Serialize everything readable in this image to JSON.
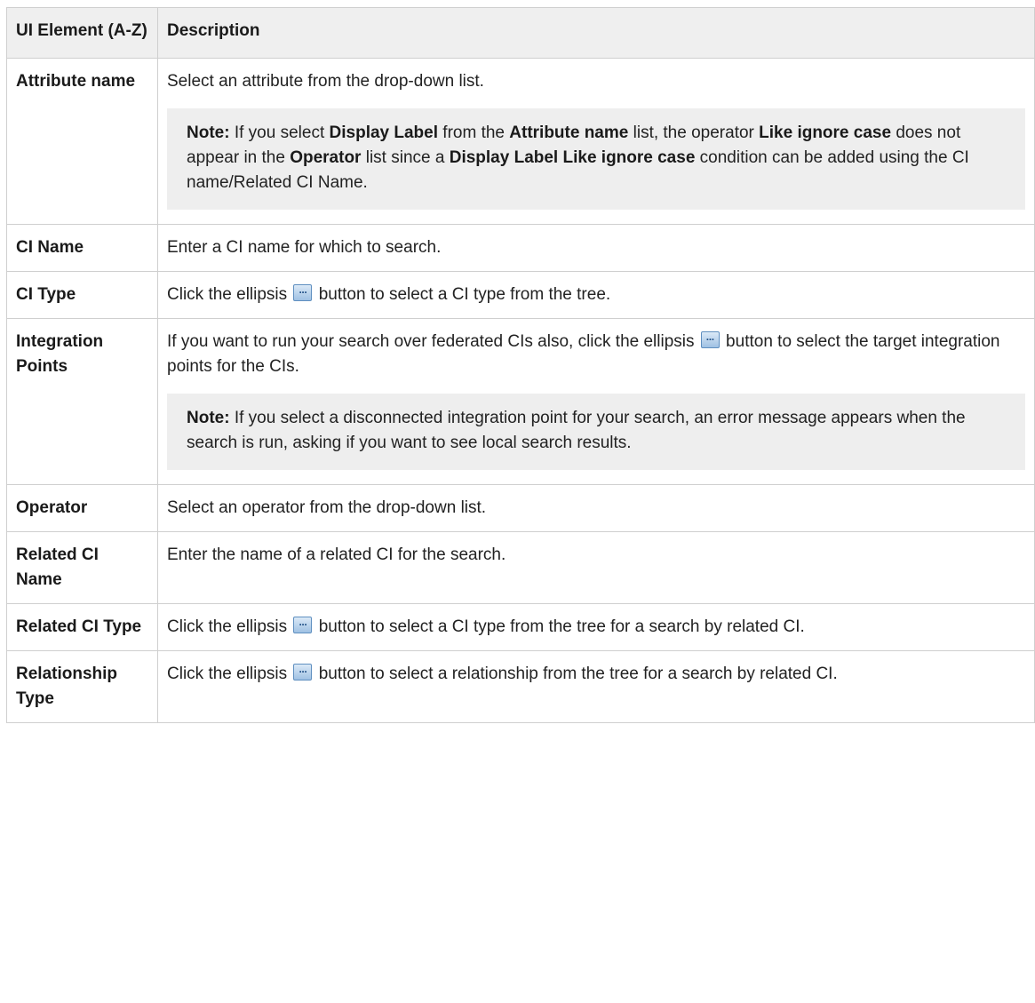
{
  "header": {
    "col1": "UI Element (A-Z)",
    "col2": "Description"
  },
  "icons": {
    "ellipsis_button": "ellipsis-button-icon",
    "ellipsis_glyph": "···"
  },
  "rows": {
    "attribute_name": {
      "element": "Attribute name",
      "desc": "Select an attribute from the drop-down list.",
      "note": {
        "label": "Note:",
        "t1": " If you select ",
        "b1": "Display Label",
        "t2": " from the ",
        "b2": "Attribute name",
        "t3": " list, the operator ",
        "b3": "Like ignore case",
        "t4": " does not appear in the ",
        "b4": "Operator",
        "t5": " list since a ",
        "b5": "Display Label Like ignore case",
        "t6": " condition can be added using the CI name/Related CI Name."
      }
    },
    "ci_name": {
      "element": "CI Name",
      "desc": "Enter a CI name for which to search."
    },
    "ci_type": {
      "element": "CI Type",
      "desc_before": "Click the ellipsis ",
      "desc_after": " button to select a CI type from the tree."
    },
    "integration_points": {
      "element": "Integration Points",
      "desc_before": "If you want to run your search over federated CIs also, click the ellipsis ",
      "desc_after": " button to select the target integration points for the CIs.",
      "note": {
        "label": "Note:",
        "text": " If you select a disconnected integration point for your search, an error message appears when the search is run, asking if you want to see local search results."
      }
    },
    "operator": {
      "element": "Operator",
      "desc": "Select an operator from the drop-down list."
    },
    "related_ci_name": {
      "element": "Related CI Name",
      "desc": "Enter the name of a related CI for the search."
    },
    "related_ci_type": {
      "element": "Related CI Type",
      "desc_before": "Click the ellipsis ",
      "desc_after": " button to select a CI type from the tree for a search by related CI."
    },
    "relationship_type": {
      "element": "Relationship Type",
      "desc_before": "Click the ellipsis ",
      "desc_after": " button to select a relationship from the tree for a search by related CI."
    }
  }
}
